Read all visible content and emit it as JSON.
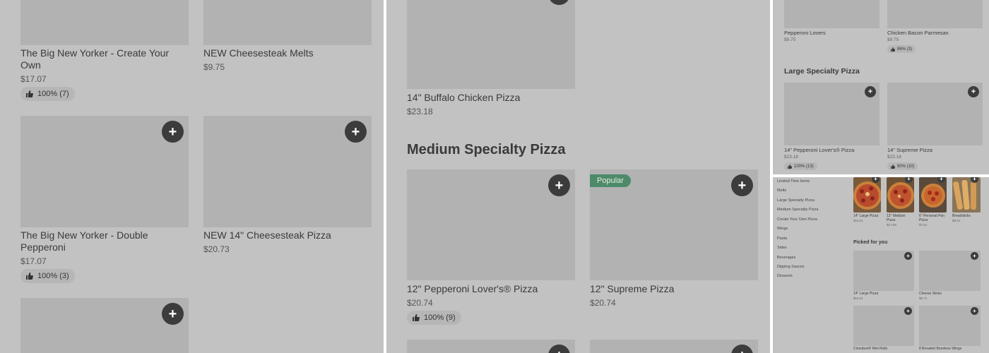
{
  "panel1": {
    "items": [
      {
        "name": "The Big New Yorker - Create Your Own",
        "price": "$17.07",
        "rating": "100% (7)"
      },
      {
        "name": "NEW Cheesesteak Melts",
        "price": "$9.75"
      },
      {
        "name": "The Big New Yorker - Double Pepperoni",
        "price": "$17.07",
        "rating": "100% (3)"
      },
      {
        "name": "NEW 14\" Cheesesteak Pizza",
        "price": "$20.73"
      }
    ]
  },
  "panel2": {
    "top_item": {
      "name": "14\" Buffalo Chicken Pizza",
      "price": "$23.18"
    },
    "section_title": "Medium Specialty Pizza",
    "items": [
      {
        "name": "12\" Pepperoni Lover's® Pizza",
        "price": "$20.74",
        "rating": "100% (9)"
      },
      {
        "name": "12\" Supreme Pizza",
        "price": "$20.74",
        "tag": "Popular"
      }
    ]
  },
  "panel3": {
    "top_items": [
      {
        "name": "Pepperoni Lovers",
        "price": "$9.75"
      },
      {
        "name": "Chicken Bacon Parmesan",
        "price": "$9.75",
        "rating": "86% (3)"
      }
    ],
    "section_title": "Large Specialty Pizza",
    "items": [
      {
        "name": "14\" Pepperoni Lover's® Pizza",
        "price": "$23.18",
        "rating": "100% (13)"
      },
      {
        "name": "14\" Supreme Pizza",
        "price": "$23.18",
        "rating": "90% (10)"
      }
    ]
  },
  "panel4": {
    "nav": [
      "Limited Time Items",
      "Melts",
      "Large Specialty Pizza",
      "Medium Specialty Pizza",
      "Create Your Own Pizza",
      "Wings",
      "Pasta",
      "Sides",
      "Beverages",
      "Dipping Sauces",
      "Desserts"
    ],
    "top_items": [
      {
        "name": "14\" Large Pizza",
        "price": "$16.51"
      },
      {
        "name": "12\" Medium Pizza",
        "price": "$17.09"
      },
      {
        "name": "6\" Personal Pan Pizza",
        "price": "$7.51"
      },
      {
        "name": "Breadsticks",
        "price": "$8.51"
      }
    ],
    "section_title": "Picked for you",
    "picked": [
      {
        "name": "14\" Large Pizza",
        "price": "$16.51"
      },
      {
        "name": "Cheese Sticks",
        "price": "$8.71"
      },
      {
        "name": "Cinnabon® Mini Rolls",
        "price": ""
      },
      {
        "name": "8 Breaded Boneless Wings",
        "price": ""
      }
    ]
  },
  "icons": {
    "add": "plus-icon",
    "rating": "thumbs-up-icon"
  },
  "colors": {
    "overlay": "#c2c2c2",
    "image_placeholder": "#b2b2b2",
    "button": "#3c3c3c",
    "popular": "#4d8a69"
  }
}
